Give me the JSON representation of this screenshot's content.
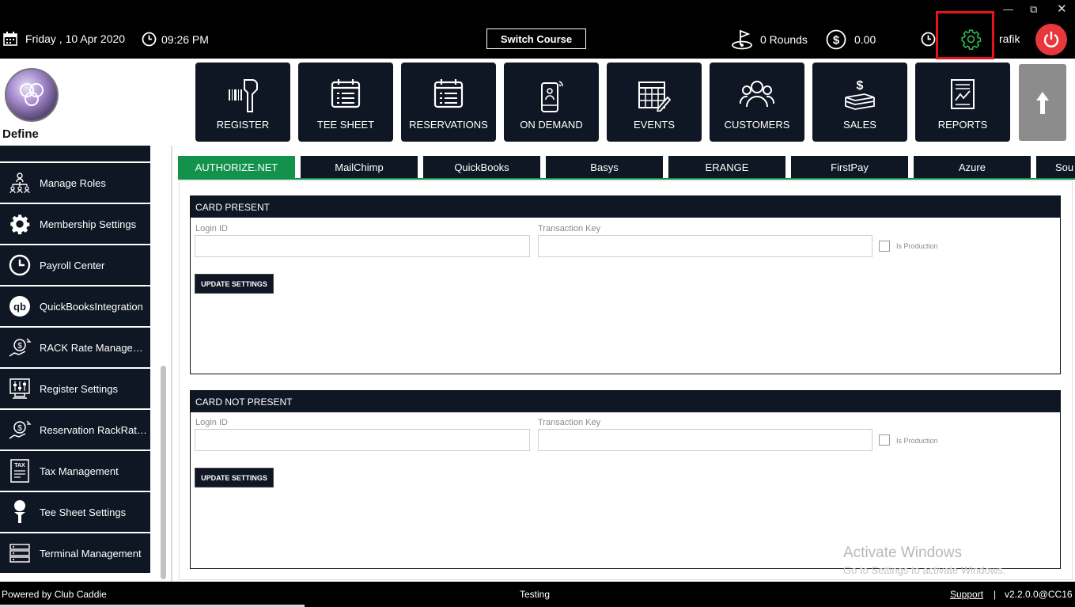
{
  "header": {
    "date": "Friday ,  10 Apr 2020",
    "time": "09:26 PM",
    "switch_course": "Switch Course",
    "rounds": "0 Rounds",
    "amount": "0.00",
    "user": "rafik"
  },
  "logo": {
    "title": "Define"
  },
  "nav_tiles": [
    {
      "label": "REGISTER"
    },
    {
      "label": "TEE SHEET"
    },
    {
      "label": "RESERVATIONS"
    },
    {
      "label": "ON DEMAND"
    },
    {
      "label": "EVENTS"
    },
    {
      "label": "CUSTOMERS"
    },
    {
      "label": "SALES"
    },
    {
      "label": "REPORTS"
    }
  ],
  "sidebar": {
    "items": [
      {
        "label": "Manage Roles",
        "icon": "org-chart-icon"
      },
      {
        "label": "Membership Settings",
        "icon": "gear-icon"
      },
      {
        "label": "Payroll Center",
        "icon": "clock-icon"
      },
      {
        "label": "QuickBooksIntegration",
        "icon": "quickbooks-icon"
      },
      {
        "label": "RACK Rate Manageme...",
        "icon": "dollar-hand-icon"
      },
      {
        "label": "Register Settings",
        "icon": "register-settings-icon"
      },
      {
        "label": "Reservation RackRate...",
        "icon": "dollar-hand-icon"
      },
      {
        "label": "Tax Management",
        "icon": "tax-icon"
      },
      {
        "label": "Tee Sheet Settings",
        "icon": "golf-tee-icon"
      },
      {
        "label": "Terminal Management",
        "icon": "terminal-icon"
      }
    ]
  },
  "tabs": [
    {
      "label": "AUTHORIZE.NET",
      "active": true
    },
    {
      "label": "MailChimp"
    },
    {
      "label": "QuickBooks"
    },
    {
      "label": "Basys"
    },
    {
      "label": "ERANGE"
    },
    {
      "label": "FirstPay"
    },
    {
      "label": "Azure"
    },
    {
      "label": "Sou"
    }
  ],
  "panels": {
    "card_present": {
      "title": "CARD PRESENT",
      "login_label": "Login ID",
      "login_value": "",
      "key_label": "Transaction Key",
      "key_value": "",
      "production_label": "Is Production",
      "button": "UPDATE SETTINGS"
    },
    "card_not_present": {
      "title": "CARD NOT PRESENT",
      "login_label": "Login ID",
      "login_value": "",
      "key_label": "Transaction Key",
      "key_value": "",
      "production_label": "Is Production",
      "button": "UPDATE SETTINGS"
    }
  },
  "watermark": {
    "line1": "Activate Windows",
    "line2": "Go to Settings to activate Windows."
  },
  "footer": {
    "powered": "Powered by Club Caddie",
    "env": "Testing",
    "support": "Support",
    "separator": "|",
    "version": "v2.2.0.0@CC16"
  },
  "colors": {
    "dark": "#0f1624",
    "accent_green": "#12924a",
    "power_red": "#e8383d",
    "highlight_red": "#e5141b"
  }
}
